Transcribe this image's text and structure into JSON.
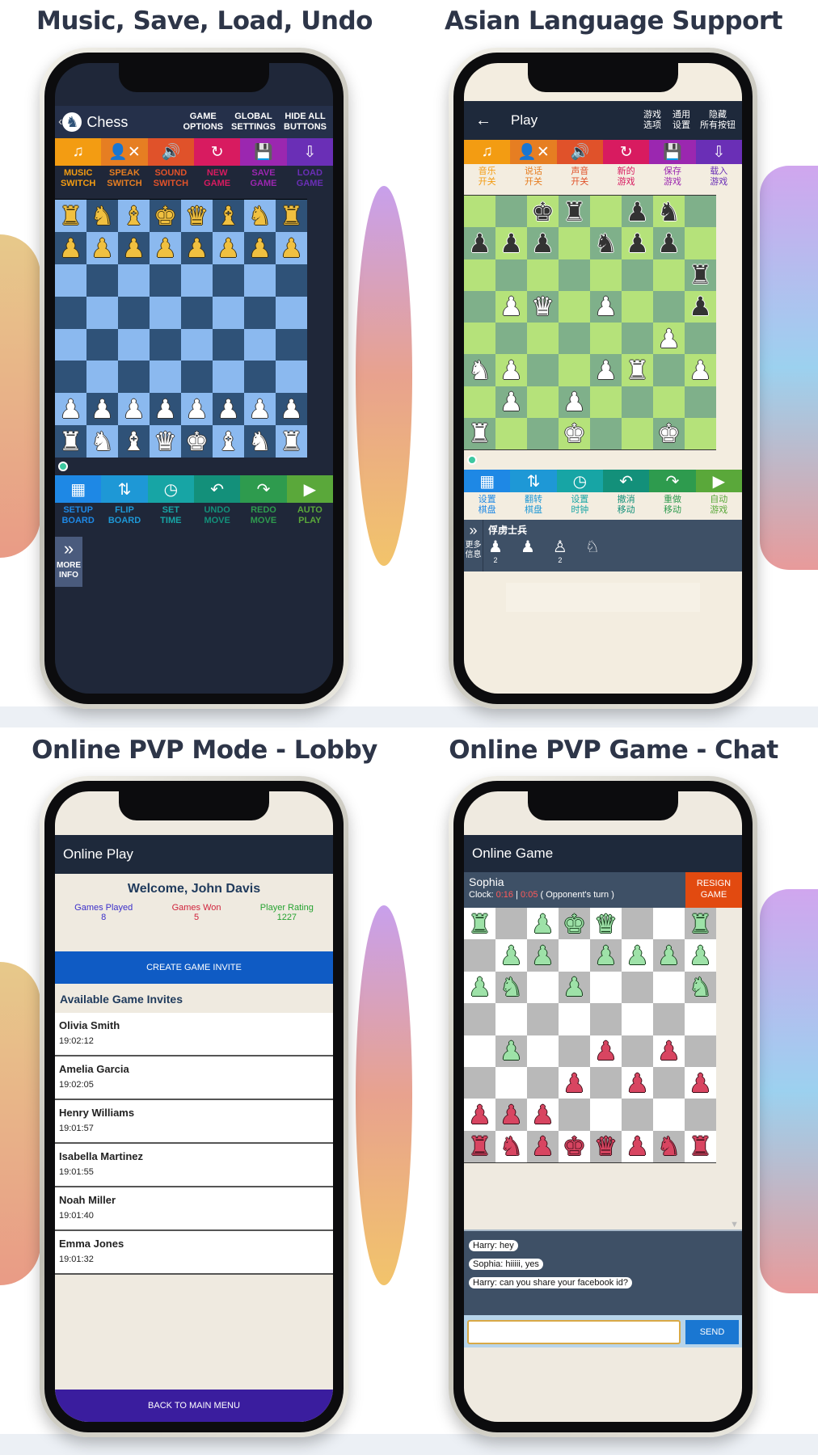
{
  "panels": [
    {
      "heading": "Music, Save, Load, Undo",
      "app_title": "Chess",
      "top_options": [
        "GAME\nOPTIONS",
        "GLOBAL\nSETTINGS",
        "HIDE ALL\nBUTTONS"
      ],
      "top_icons": [
        {
          "icon": "music-note-icon",
          "glyph": "♫",
          "label": "MUSIC\nSWITCH",
          "color": "#f39c12"
        },
        {
          "icon": "speak-off-icon",
          "glyph": "👤✕",
          "label": "SPEAK\nSWITCH",
          "color": "#e67e22"
        },
        {
          "icon": "sound-icon",
          "glyph": "🔊",
          "label": "SOUND\nSWITCH",
          "color": "#e0522a"
        },
        {
          "icon": "refresh-icon",
          "glyph": "↻",
          "label": "NEW\nGAME",
          "color": "#d81b60"
        },
        {
          "icon": "save-icon",
          "glyph": "💾",
          "label": "SAVE\nGAME",
          "color": "#9b27b0"
        },
        {
          "icon": "load-icon",
          "glyph": "⇩",
          "label": "LOAD\nGAME",
          "color": "#6a2fb6"
        }
      ],
      "bottom_icons": [
        {
          "icon": "setup-board-icon",
          "glyph": "▦",
          "label": "SETUP\nBOARD",
          "color": "#1e88e5"
        },
        {
          "icon": "flip-board-icon",
          "glyph": "⇅",
          "label": "FLIP\nBOARD",
          "color": "#1e98d6"
        },
        {
          "icon": "clock-icon",
          "glyph": "◷",
          "label": "SET\nTIME",
          "color": "#17a5a5"
        },
        {
          "icon": "undo-icon",
          "glyph": "↶",
          "label": "UNDO\nMOVE",
          "color": "#13907a"
        },
        {
          "icon": "redo-icon",
          "glyph": "↷",
          "label": "REDO\nMOVE",
          "color": "#2e9b4e"
        },
        {
          "icon": "play-icon",
          "glyph": "▶",
          "label": "AUTO\nPLAY",
          "color": "#5aa83a"
        }
      ],
      "more_info": "MORE\nINFO"
    },
    {
      "heading": "Asian Language Support",
      "app_title": "Play",
      "top_options": [
        "游戏\n选项",
        "通用\n设置",
        "隐藏\n所有按钮"
      ],
      "top_icons": [
        {
          "icon": "music-note-icon",
          "glyph": "♫",
          "label": "音乐\n开关",
          "color": "#f39c12"
        },
        {
          "icon": "speak-off-icon",
          "glyph": "👤✕",
          "label": "说话\n开关",
          "color": "#e67e22"
        },
        {
          "icon": "sound-icon",
          "glyph": "🔊",
          "label": "声音\n开关",
          "color": "#e0522a"
        },
        {
          "icon": "refresh-icon",
          "glyph": "↻",
          "label": "新的\n游戏",
          "color": "#d81b60"
        },
        {
          "icon": "save-icon",
          "glyph": "💾",
          "label": "保存\n游戏",
          "color": "#9b27b0"
        },
        {
          "icon": "load-icon",
          "glyph": "⇩",
          "label": "载入\n游戏",
          "color": "#6a2fb6"
        }
      ],
      "bottom_icons": [
        {
          "icon": "setup-board-icon",
          "glyph": "▦",
          "label": "设置\n棋盘",
          "color": "#1e88e5"
        },
        {
          "icon": "flip-board-icon",
          "glyph": "⇅",
          "label": "翻转\n棋盘",
          "color": "#1e98d6"
        },
        {
          "icon": "clock-icon",
          "glyph": "◷",
          "label": "设置\n时钟",
          "color": "#17a5a5"
        },
        {
          "icon": "undo-icon",
          "glyph": "↶",
          "label": "撤消\n移动",
          "color": "#13907a"
        },
        {
          "icon": "redo-icon",
          "glyph": "↷",
          "label": "重做\n移动",
          "color": "#2e9b4e"
        },
        {
          "icon": "play-icon",
          "glyph": "▶",
          "label": "自动\n游戏",
          "color": "#5aa83a"
        }
      ],
      "more_info": "更多\n信息",
      "captured_title": "俘虏士兵",
      "captured": [
        {
          "glyph": "♟",
          "count": "2"
        },
        {
          "glyph": "♟",
          "count": ""
        },
        {
          "glyph": "♙",
          "count": "2"
        },
        {
          "glyph": "♘",
          "count": ""
        }
      ]
    },
    {
      "heading": "Online PVP Mode - Lobby",
      "app_title": "Online Play",
      "welcome": "Welcome, John Davis",
      "stats": [
        {
          "label": "Games Played",
          "value": "8",
          "color": "#3b2fc9"
        },
        {
          "label": "Games Won",
          "value": "5",
          "color": "#d0233c"
        },
        {
          "label": "Player Rating",
          "value": "1227",
          "color": "#27a332"
        }
      ],
      "create_invite": "CREATE GAME INVITE",
      "invites_title": "Available Game Invites",
      "invites": [
        {
          "name": "Olivia Smith",
          "time": "19:02:12"
        },
        {
          "name": "Amelia Garcia",
          "time": "19:02:05"
        },
        {
          "name": "Henry Williams",
          "time": "19:01:57"
        },
        {
          "name": "Isabella Martinez",
          "time": "19:01:55"
        },
        {
          "name": "Noah Miller",
          "time": "19:01:40"
        },
        {
          "name": "Emma Jones",
          "time": "19:01:32"
        }
      ],
      "back_button": "BACK TO MAIN MENU"
    },
    {
      "heading": "Online PVP Game - Chat",
      "app_title": "Online Game",
      "opponent": "Sophia",
      "clock_label": "Clock:",
      "clock_time_1": "0:16",
      "clock_sep": "|",
      "clock_time_2": "0:05",
      "clock_status": "( Opponent's turn )",
      "resign": "RESIGN\nGAME",
      "chat": [
        "Harry: hey",
        "Sophia: hiiiii, yes",
        "Harry: can you share your facebook id?"
      ],
      "send": "SEND",
      "message_value": ""
    }
  ],
  "boards": {
    "blue": {
      "light": "#8bb9ef",
      "dark": "#2f5278",
      "rows": [
        "rnbkqbnr",
        "pppppppp",
        "........",
        "........",
        "........",
        "........",
        "PPPPPPPP",
        "RNBQKBNR"
      ]
    },
    "green": {
      "light": "#b5e27a",
      "dark": "#7fb08a",
      "rows": [
        "..kr.pn.",
        "ppp.npp.",
        ".......r",
        ".PQ.P..p",
        "......P.",
        "NP..PR.P",
        ".P.P....",
        "R..K..K."
      ]
    },
    "gray": {
      "light": "#ffffff",
      "dark": "#b9b9b9",
      "rows": [
        "R.PKQ..R",
        ".PP.PPPP",
        "PN.P...N",
        "........",
        ".P..p.p.",
        "...p.p.p",
        "ppp.....",
        "rnpkqpnr"
      ]
    }
  }
}
